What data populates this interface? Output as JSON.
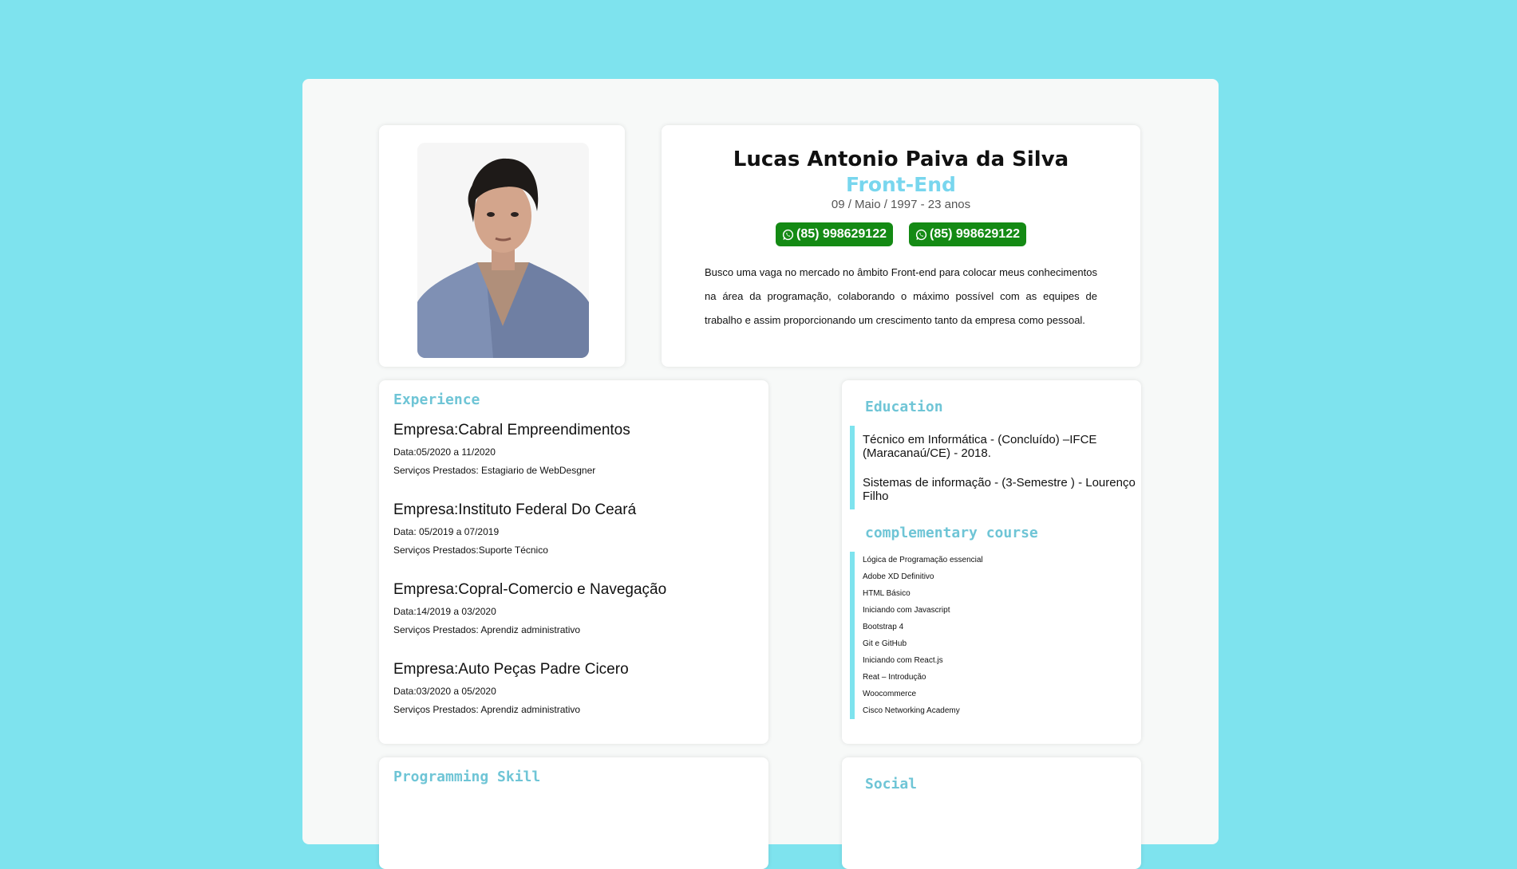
{
  "profile": {
    "name": "Lucas Antonio Paiva da Silva",
    "role": "Front-End",
    "birth": "09 / Maio / 1997 - 23 anos",
    "phones": [
      "(85) 998629122",
      "(85) 998629122"
    ],
    "summary": "Busco uma vaga no mercado no âmbito Front-end para colocar meus conhecimentos na área da programação, colaborando o máximo possível com as equipes de trabalho e assim proporcionando um crescimento tanto da empresa como pessoal."
  },
  "experience": {
    "title": "Experience",
    "items": [
      {
        "company": "Empresa:Cabral Empreendimentos",
        "date": "Data:05/2020 a 11/2020",
        "services": "Serviços Prestados: Estagiario de WebDesgner"
      },
      {
        "company": "Empresa:Instituto Federal Do Ceará",
        "date": "Data: 05/2019 a 07/2019",
        "services": "Serviços Prestados:Suporte Técnico"
      },
      {
        "company": "Empresa:Copral-Comercio e Navegação",
        "date": "Data:14/2019 a 03/2020",
        "services": "Serviços Prestados: Aprendiz administrativo"
      },
      {
        "company": "Empresa:Auto Peças Padre Cicero",
        "date": "Data:03/2020 a 05/2020",
        "services": "Serviços Prestados: Aprendiz administrativo"
      }
    ]
  },
  "education": {
    "title": "Education",
    "entries": [
      "Técnico em Informática - (Concluído) –IFCE (Maracanaú/CE) - 2018.",
      "Sistemas de informação - (3-Semestre ) - Lourenço Filho"
    ],
    "courses_title": "complementary course",
    "courses": [
      "Lógica de Programação essencial",
      "Adobe XD Definitivo",
      "HTML Básico",
      "Iniciando com Javascript",
      "Bootstrap 4",
      "Git e GitHub",
      "Iniciando com React.js",
      "Reat – Introdução",
      "Woocommerce",
      "Cisco Networking Academy"
    ]
  },
  "programming": {
    "title": "Programming Skill"
  },
  "social": {
    "title": "Social"
  },
  "colors": {
    "background": "#7ee3ee",
    "accent": "#78d6ee",
    "whatsapp_button": "#148a14"
  },
  "icons": {
    "phone": "whatsapp-icon"
  }
}
